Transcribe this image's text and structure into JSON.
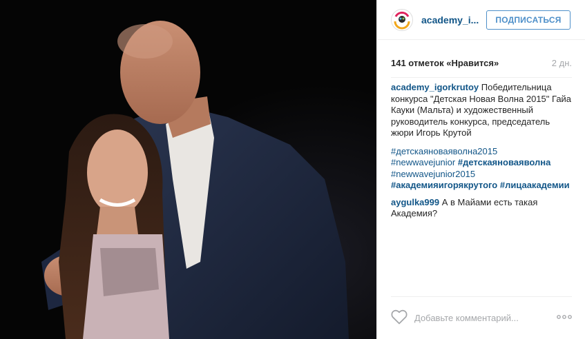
{
  "header": {
    "username": "academy_i...",
    "follow_label": "ПОДПИСАТЬСЯ"
  },
  "post": {
    "likes": "141 отметок «Нравится»",
    "age": "2 дн.",
    "caption": {
      "user": "academy_igorkrutoy",
      "text": "Победительница конкурса \"Детская Новая Волна 2015\" Гайа Кауки (Мальта) и художественный руководитель конкурса, председатель жюри Игорь Крутой",
      "tags": [
        "#детскаяноваяволна2015",
        "#newwavejunior",
        "#детскаяноваяволна",
        "#newwavejunior2015",
        "#академияигорякрутого",
        "#лицаакадемии"
      ]
    },
    "comments": [
      {
        "user": "aygulka999",
        "text": "А в Майами есть такая Академия?"
      }
    ]
  },
  "footer": {
    "comment_placeholder": "Добавьте комментарий..."
  },
  "icons": {
    "avatar": "academy-logo-icon",
    "like": "heart-icon",
    "more": "more-dots-icon"
  },
  "colors": {
    "link": "#125688",
    "follow": "#4d8fc9",
    "muted": "#a5a7aa",
    "photo_bg": "#050505"
  }
}
